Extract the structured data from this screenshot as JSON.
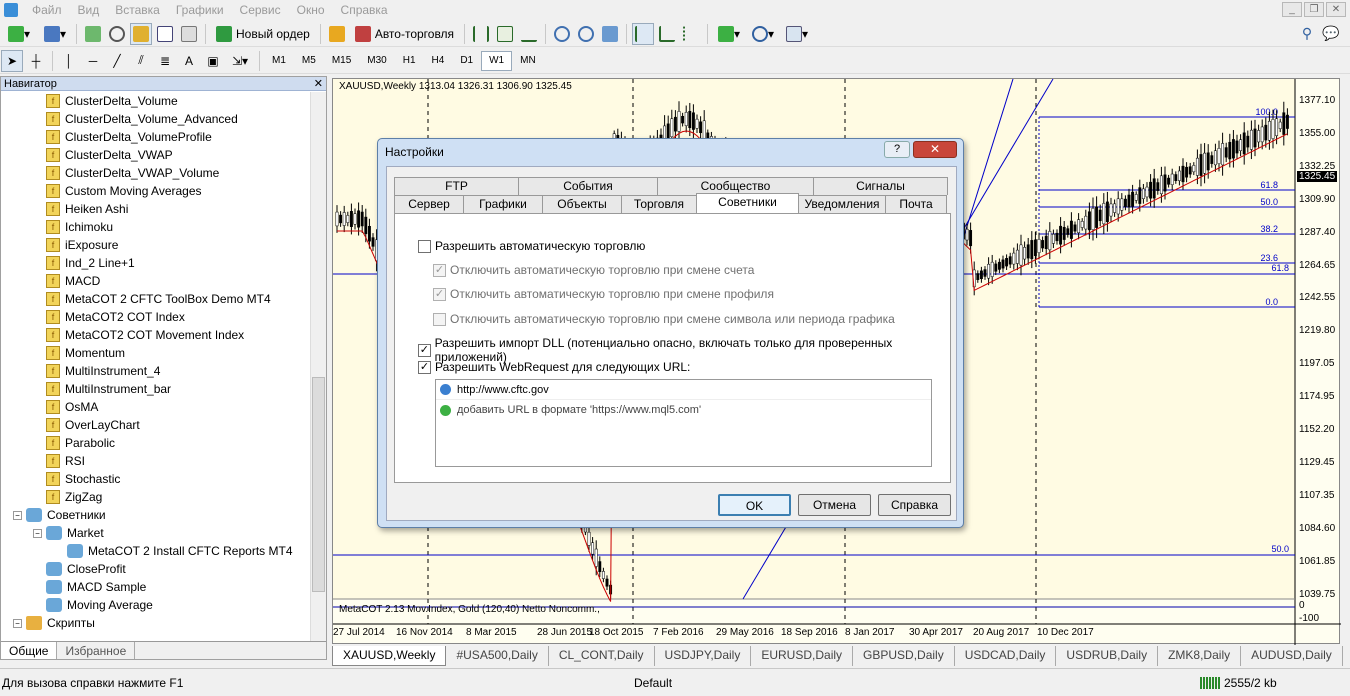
{
  "menu": [
    "Файл",
    "Вид",
    "Вставка",
    "Графики",
    "Сервис",
    "Окно",
    "Справка"
  ],
  "toolbar": {
    "new_order": "Новый ордер",
    "auto_trading": "Авто-торговля",
    "timeframes": [
      "M1",
      "M5",
      "M15",
      "M30",
      "H1",
      "H4",
      "D1",
      "W1",
      "MN"
    ],
    "selected_timeframe": "W1"
  },
  "navigator": {
    "title": "Навигатор",
    "indicators": [
      "ClusterDelta_Volume",
      "ClusterDelta_Volume_Advanced",
      "ClusterDelta_VolumeProfile",
      "ClusterDelta_VWAP",
      "ClusterDelta_VWAP_Volume",
      "Custom Moving Averages",
      "Heiken Ashi",
      "Ichimoku",
      "iExposure",
      "Ind_2 Line+1",
      "MACD",
      "MetaCOT 2 CFTC ToolBox Demo MT4",
      "MetaCOT2 COT Index",
      "MetaCOT2 COT Movement Index",
      "Momentum",
      "MultiInstrument_4",
      "MultiInstrument_bar",
      "OsMA",
      "OverLayChart",
      "Parabolic",
      "RSI",
      "Stochastic",
      "ZigZag"
    ],
    "experts_label": "Советники",
    "market_label": "Market",
    "market_item": "MetaCOT 2 Install CFTC Reports MT4",
    "experts": [
      "CloseProfit",
      "MACD Sample",
      "Moving Average"
    ],
    "scripts_label": "Скрипты",
    "tabs": [
      "Общие",
      "Избранное"
    ]
  },
  "chart": {
    "header": "XAUUSD,Weekly  1313.04 1326.31 1306.90 1325.45",
    "indicator_header": "MetaCOT 2.13 Mov.Index, Gold (120,40) Netto Noncomm.,",
    "current_price": "1325.45",
    "prices": [
      "1377.10",
      "1355.00",
      "1332.25",
      "1309.90",
      "1287.40",
      "1264.65",
      "1242.55",
      "1219.80",
      "1197.05",
      "1174.95",
      "1152.20",
      "1129.45",
      "1107.35",
      "1084.60",
      "1061.85",
      "1039.75"
    ],
    "ind_scale": [
      "0",
      "-100"
    ],
    "dates": [
      "27 Jul 2014",
      "16 Nov 2014",
      "8 Mar 2015",
      "28 Jun 2015",
      "18 Oct 2015",
      "7 Feb 2016",
      "29 May 2016",
      "18 Sep 2016",
      "8 Jan 2017",
      "30 Apr 2017",
      "20 Aug 2017",
      "10 Dec 2017"
    ],
    "fibo": [
      "100.0",
      "61.8",
      "50.0",
      "38.2",
      "23.6",
      "0.0"
    ],
    "hline_labels": [
      "61.8",
      "50.0"
    ]
  },
  "chart_tabs": [
    "XAUUSD,Weekly",
    "#USA500,Daily",
    "CL_CONT,Daily",
    "USDJPY,Daily",
    "EURUSD,Daily",
    "GBPUSD,Daily",
    "USDCAD,Daily",
    "USDRUB,Daily",
    "ZMK8,Daily",
    "AUDUSD,Daily"
  ],
  "status": {
    "help": "Для вызова справки нажмите F1",
    "profile": "Default",
    "traffic": "2555/2 kb"
  },
  "dialog": {
    "title": "Настройки",
    "tabs_top": [
      "FTP",
      "События",
      "Сообщество",
      "Сигналы"
    ],
    "tabs_bottom": [
      "Сервер",
      "Графики",
      "Объекты",
      "Торговля",
      "Советники",
      "Уведомления",
      "Почта"
    ],
    "active_tab": "Советники",
    "opt_auto": "Разрешить автоматическую торговлю",
    "opt_acc": "Отключить автоматическую торговлю при смене счета",
    "opt_prof": "Отключить автоматическую торговлю при смене профиля",
    "opt_sym": "Отключить автоматическую торговлю при смене символа или периода графика",
    "opt_dll": "Разрешить импорт DLL (потенциально опасно, включать только для проверенных приложений)",
    "opt_web": "Разрешить WebRequest для следующих URL:",
    "url1": "http://www.cftc.gov",
    "url_add": "добавить URL в формате 'https://www.mql5.com'",
    "ok": "OK",
    "cancel": "Отмена",
    "help": "Справка"
  }
}
